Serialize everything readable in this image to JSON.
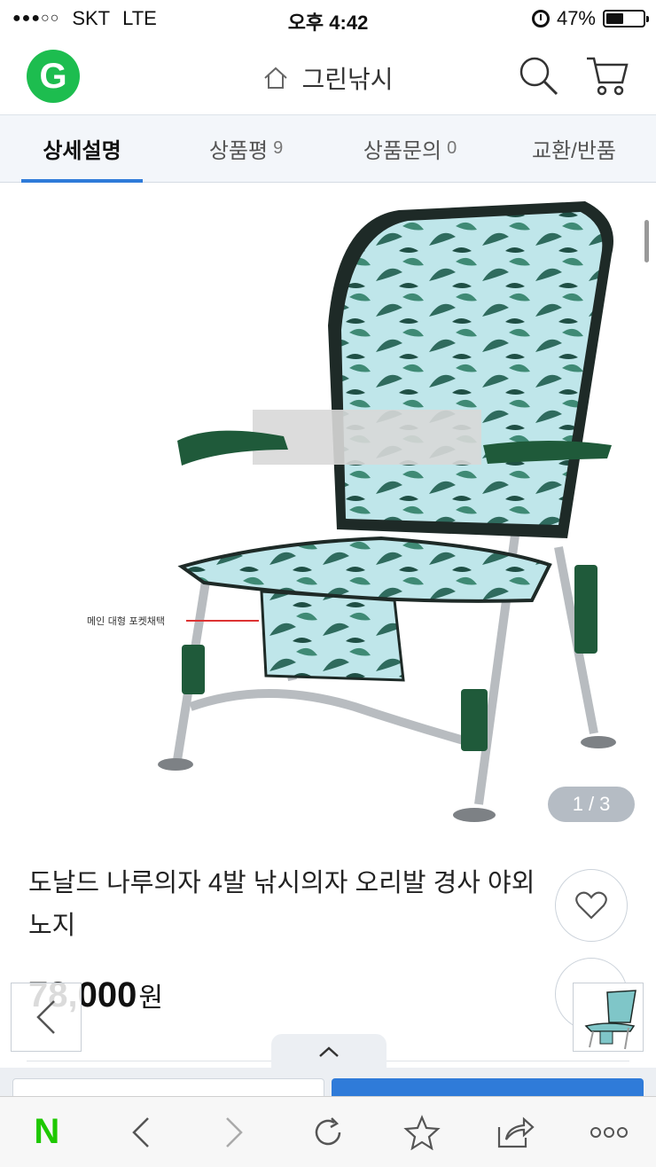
{
  "status_bar": {
    "carrier": "SKT",
    "network": "LTE",
    "time": "오후 4:42",
    "battery_percent": "47%",
    "battery_level": 0.47,
    "signal_dots": "●●●○○"
  },
  "header": {
    "shop_name": "그린낚시",
    "logo_letter": "G",
    "logo_color": "#1dbd4f"
  },
  "tabs": [
    {
      "label": "상세설명",
      "count": "",
      "active": true
    },
    {
      "label": "상품평",
      "count": "9",
      "active": false
    },
    {
      "label": "상품문의",
      "count": "0",
      "active": false
    },
    {
      "label": "교환/반품",
      "count": "",
      "active": false
    }
  ],
  "gallery": {
    "current": "1",
    "separator": "/",
    "total": "3",
    "annotation_text": "메인 대형 포켓채택"
  },
  "product": {
    "title": "도날드 나루의자 4발 낚시의자 오리발 경사 야외 노지",
    "price": "78,000",
    "currency": "원"
  },
  "toolbar": {
    "naver_label": "N",
    "icons": [
      "naver-home-icon",
      "back-icon",
      "forward-icon",
      "reload-icon",
      "bookmark-star-icon",
      "share-icon",
      "more-icon"
    ]
  },
  "colors": {
    "accent_blue": "#2f7bd9",
    "naver_green": "#1ec800"
  }
}
